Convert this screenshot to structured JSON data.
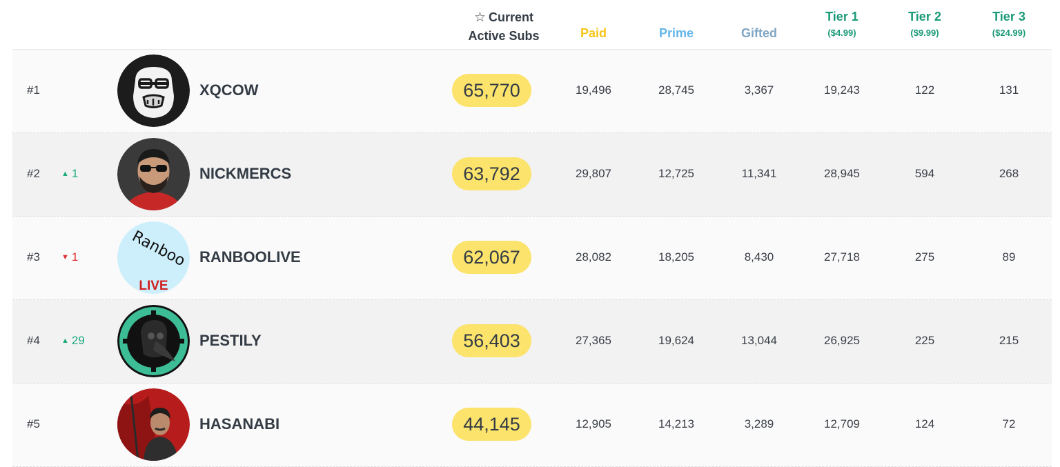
{
  "header": {
    "active_line1": "Current",
    "active_line2": "Active Subs",
    "paid": "Paid",
    "prime": "Prime",
    "gifted": "Gifted",
    "tier1": "Tier 1",
    "tier1_price": "($4.99)",
    "tier2": "Tier 2",
    "tier2_price": "($9.99)",
    "tier3": "Tier 3",
    "tier3_price": "($24.99)"
  },
  "colors": {
    "highlight_pill": "#fce36c",
    "paid": "#f5c518",
    "prime": "#63b6e8",
    "gifted": "#7fa6c4",
    "tier": "#1a9a78",
    "rank_up": "#1faa80",
    "rank_down": "#e03131"
  },
  "icons": {
    "header_star": "star-outline-icon"
  },
  "rows": [
    {
      "rank": "#1",
      "change": "",
      "change_dir": "none",
      "name": "XQCOW",
      "avatar": "gorilla-glasses-avatar",
      "active": "65,770",
      "paid": "19,496",
      "prime": "28,745",
      "gifted": "3,367",
      "tier1": "19,243",
      "tier2": "122",
      "tier3": "131"
    },
    {
      "rank": "#2",
      "change": "1",
      "change_dir": "up",
      "name": "NICKMERCS",
      "avatar": "man-sunglasses-avatar",
      "active": "63,792",
      "paid": "29,807",
      "prime": "12,725",
      "gifted": "11,341",
      "tier1": "28,945",
      "tier2": "594",
      "tier3": "268"
    },
    {
      "rank": "#3",
      "change": "1",
      "change_dir": "down",
      "name": "RANBOOLIVE",
      "avatar": "ranboo-live-avatar",
      "avatar_text": "Ranboo",
      "avatar_badge": "LIVE",
      "active": "62,067",
      "paid": "28,082",
      "prime": "18,205",
      "gifted": "8,430",
      "tier1": "27,718",
      "tier2": "275",
      "tier3": "89"
    },
    {
      "rank": "#4",
      "change": "29",
      "change_dir": "up",
      "name": "PESTILY",
      "avatar": "plague-doctor-avatar",
      "active": "56,403",
      "paid": "27,365",
      "prime": "19,624",
      "gifted": "13,044",
      "tier1": "26,925",
      "tier2": "225",
      "tier3": "215"
    },
    {
      "rank": "#5",
      "change": "",
      "change_dir": "none",
      "name": "HASANABI",
      "avatar": "man-red-flag-avatar",
      "active": "44,145",
      "paid": "12,905",
      "prime": "14,213",
      "gifted": "3,289",
      "tier1": "12,709",
      "tier2": "124",
      "tier3": "72"
    }
  ]
}
